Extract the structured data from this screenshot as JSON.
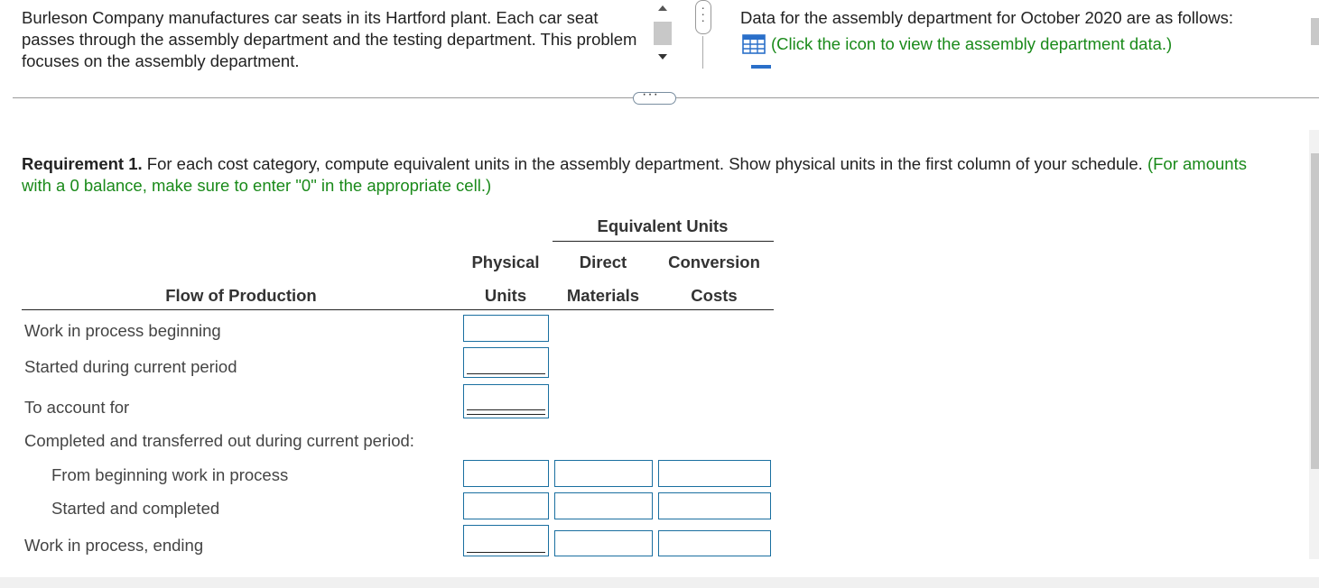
{
  "intro": {
    "text": "Burleson Company manufactures car seats in its Hartford plant. Each car seat passes through the assembly department and the testing department. This problem focuses on the assembly department."
  },
  "data_panel": {
    "text": "Data for the assembly department for October 2020 are as follows:",
    "link": "(Click the icon to view the assembly department data.)",
    "icon": "table-grid-icon"
  },
  "requirement": {
    "label": "Requirement 1.",
    "text": " For each cost category, compute equivalent units in the assembly department. Show physical units in the first column of your schedule. ",
    "note": "(For amounts with a 0 balance, make sure to enter \"0\" in the appropriate cell.)"
  },
  "table": {
    "group_header": "Equivalent Units",
    "col_physical_1": "Physical",
    "col_physical_2": "Units",
    "col_dm_1": "Direct",
    "col_dm_2": "Materials",
    "col_cc_1": "Conversion",
    "col_cc_2": "Costs",
    "col_flow": "Flow of Production",
    "rows": [
      "Work in process beginning",
      "Started during current period",
      "To account for",
      "Completed and transferred out during current period:",
      "From beginning work in process",
      "Started and completed",
      "Work in process, ending"
    ]
  },
  "colors": {
    "accent_green": "#1a8a1a",
    "input_border": "#1a6fa0"
  }
}
